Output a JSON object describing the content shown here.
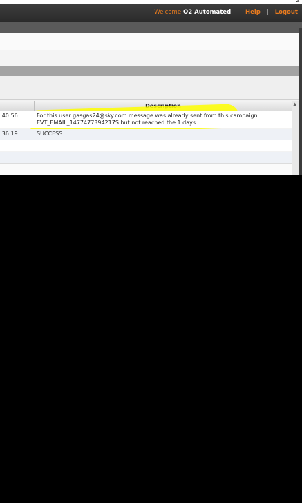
{
  "header": {
    "welcome_label": "Welcome",
    "user_name": "O2 Automated",
    "separator": "|",
    "help_label": "Help",
    "logout_label": "Logout",
    "corner_glyph": "2"
  },
  "table": {
    "columns": [
      "",
      "Description"
    ],
    "rows": [
      {
        "time": ":40:56",
        "description": "For this user gasgas24@sky.com message was already sent from this campaign EVT_EMAIL_1477477394217S but not reached the 1 days."
      },
      {
        "time": ":36:19",
        "description": "SUCCESS"
      }
    ]
  },
  "highlight_color": "#ffff00",
  "accent_color": "#e87a1e"
}
